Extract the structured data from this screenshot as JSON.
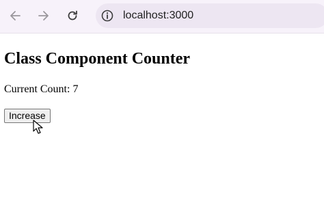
{
  "browser": {
    "back_icon": "arrow-left-icon",
    "forward_icon": "arrow-right-icon",
    "reload_icon": "reload-icon",
    "site_info_icon": "info-circle-icon",
    "url": "localhost:3000"
  },
  "page": {
    "heading": "Class Component Counter",
    "count_text": "Current Count: 7",
    "button_label": "Increase"
  },
  "cursor_icon": "arrow-cursor-icon"
}
